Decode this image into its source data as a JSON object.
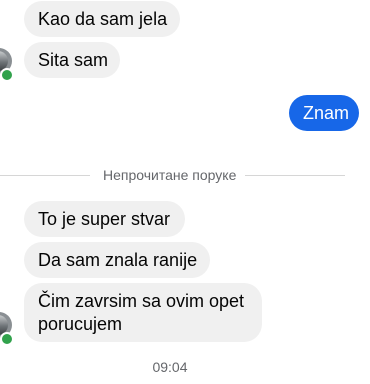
{
  "messages": {
    "received_top": [
      {
        "text": "Kao da sam jela"
      },
      {
        "text": "Sita sam"
      }
    ],
    "sent": [
      {
        "text": "Znam"
      }
    ],
    "unread_divider": "Непрочитане поруке",
    "received_bottom": [
      {
        "text": "To je super stvar"
      },
      {
        "text": "Da sam znala ranije"
      },
      {
        "text": "Čim zavrsim sa ovim opet porucujem"
      }
    ],
    "timestamp": "09:04"
  },
  "colors": {
    "sent_bubble": "#1767e8",
    "received_bubble": "#f0f0f0",
    "online_status": "#31a24c"
  }
}
